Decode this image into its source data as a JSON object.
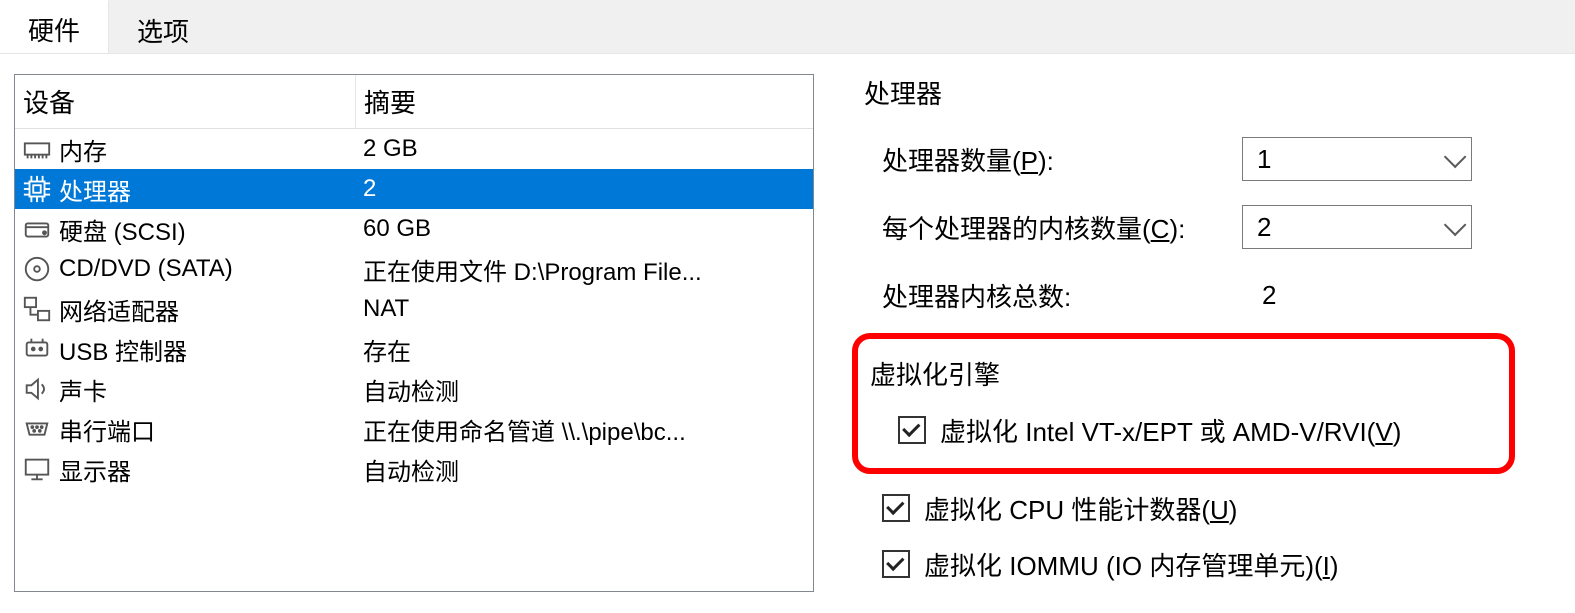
{
  "tabs": {
    "hardware": "硬件",
    "options": "选项"
  },
  "device_table": {
    "header_device": "设备",
    "header_summary": "摘要",
    "rows": [
      {
        "icon": "memory",
        "name": "内存",
        "summary": "2 GB"
      },
      {
        "icon": "cpu",
        "name": "处理器",
        "summary": "2"
      },
      {
        "icon": "hdd",
        "name": "硬盘 (SCSI)",
        "summary": "60 GB"
      },
      {
        "icon": "cd",
        "name": "CD/DVD (SATA)",
        "summary": "正在使用文件 D:\\Program File..."
      },
      {
        "icon": "net",
        "name": "网络适配器",
        "summary": "NAT"
      },
      {
        "icon": "usb",
        "name": "USB 控制器",
        "summary": "存在"
      },
      {
        "icon": "sound",
        "name": "声卡",
        "summary": "自动检测"
      },
      {
        "icon": "serial",
        "name": "串行端口",
        "summary": "正在使用命名管道 \\\\.\\pipe\\bc..."
      },
      {
        "icon": "display",
        "name": "显示器",
        "summary": "自动检测"
      }
    ],
    "selected_index": 1
  },
  "processor_group": {
    "title": "处理器",
    "num_processors_label": "处理器数量(",
    "num_processors_hotkey": "P",
    "num_processors_label_after": "):",
    "num_processors_value": "1",
    "cores_per_label": "每个处理器的内核数量(",
    "cores_per_hotkey": "C",
    "cores_per_label_after": "):",
    "cores_per_value": "2",
    "total_label": "处理器内核总数:",
    "total_value": "2"
  },
  "virt_group": {
    "title": "虚拟化引擎",
    "opt1_prefix": "虚拟化 Intel VT-x/EPT 或 AMD-V/RVI(",
    "opt1_hotkey": "V",
    "opt1_suffix": ")",
    "opt1_checked": true,
    "opt2_prefix": "虚拟化 CPU 性能计数器(",
    "opt2_hotkey": "U",
    "opt2_suffix": ")",
    "opt2_checked": true,
    "opt3_prefix": "虚拟化 IOMMU (IO 内存管理单元)(",
    "opt3_hotkey": "I",
    "opt3_suffix": ")",
    "opt3_checked": true
  }
}
